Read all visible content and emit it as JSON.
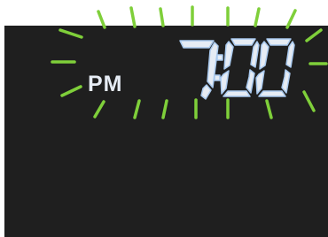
{
  "display": {
    "meridiem": "PM",
    "time": "7:00",
    "hour": "7",
    "minutes": "00"
  },
  "colors": {
    "lcd_background": "#1f1f1f",
    "digit_color": "#e6ecf4",
    "digit_outline": "#a9c9ee",
    "ray_color": "#7fcf3a"
  },
  "icons": {
    "flash_rays": "flashing-rays-icon"
  }
}
